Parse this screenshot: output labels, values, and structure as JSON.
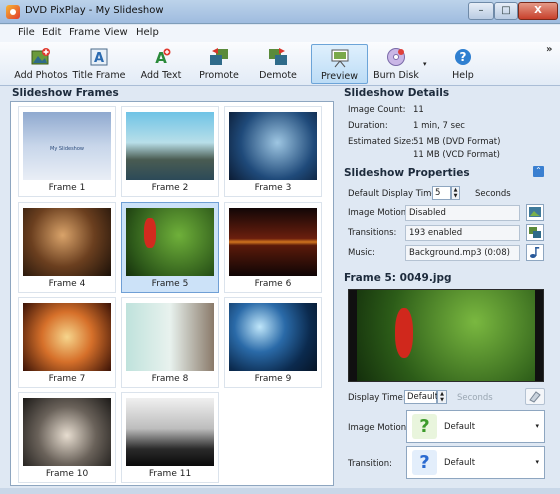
{
  "window": {
    "title": "DVD PixPlay - My Slideshow",
    "min": "–",
    "max": "□",
    "close": "X"
  },
  "menu": [
    "File",
    "Edit",
    "Frame",
    "View",
    "Help"
  ],
  "toolbar": {
    "add_photos": "Add Photos",
    "title_frame": "Title Frame",
    "add_text": "Add Text",
    "promote": "Promote",
    "demote": "Demote",
    "preview": "Preview",
    "burn_disk": "Burn Disk",
    "help": "Help",
    "dropdown_arrow": "▾",
    "overflow": "»"
  },
  "frames": {
    "title": "Slideshow Frames",
    "thumb_title_text": "My Slideshow",
    "items": [
      "Frame 1",
      "Frame 2",
      "Frame 3",
      "Frame 4",
      "Frame 5",
      "Frame 6",
      "Frame 7",
      "Frame 8",
      "Frame 9",
      "Frame 10",
      "Frame 11"
    ],
    "selected": "Frame 5"
  },
  "details": {
    "title": "Slideshow Details",
    "image_count_label": "Image Count:",
    "image_count": "11",
    "duration_label": "Duration:",
    "duration": "1 min, 7 sec",
    "size_label": "Estimated Size:",
    "size_dvd": "51 MB (DVD Format)",
    "size_vcd": "11 MB (VCD Format)"
  },
  "properties": {
    "title": "Slideshow Properties",
    "collapse": "⌃",
    "default_time_label": "Default Display Time:",
    "default_time": "5",
    "default_time_unit": "Seconds",
    "motion_label": "Image Motion:",
    "motion": "Disabled",
    "transitions_label": "Transitions:",
    "transitions": "193 enabled",
    "music_label": "Music:",
    "music": "Background.mp3 (0:08)"
  },
  "frame_panel": {
    "title": "Frame 5: 0049.jpg",
    "display_time_label": "Display Time:",
    "display_time": "Default",
    "display_time_unit": "Seconds",
    "motion_label": "Image Motion:",
    "motion": "Default",
    "motion_icon": "?",
    "transition_label": "Transition:",
    "transition": "Default",
    "transition_icon": "?",
    "caret": "▾"
  },
  "spin_glyphs": {
    "up": "▲",
    "down": "▼"
  }
}
